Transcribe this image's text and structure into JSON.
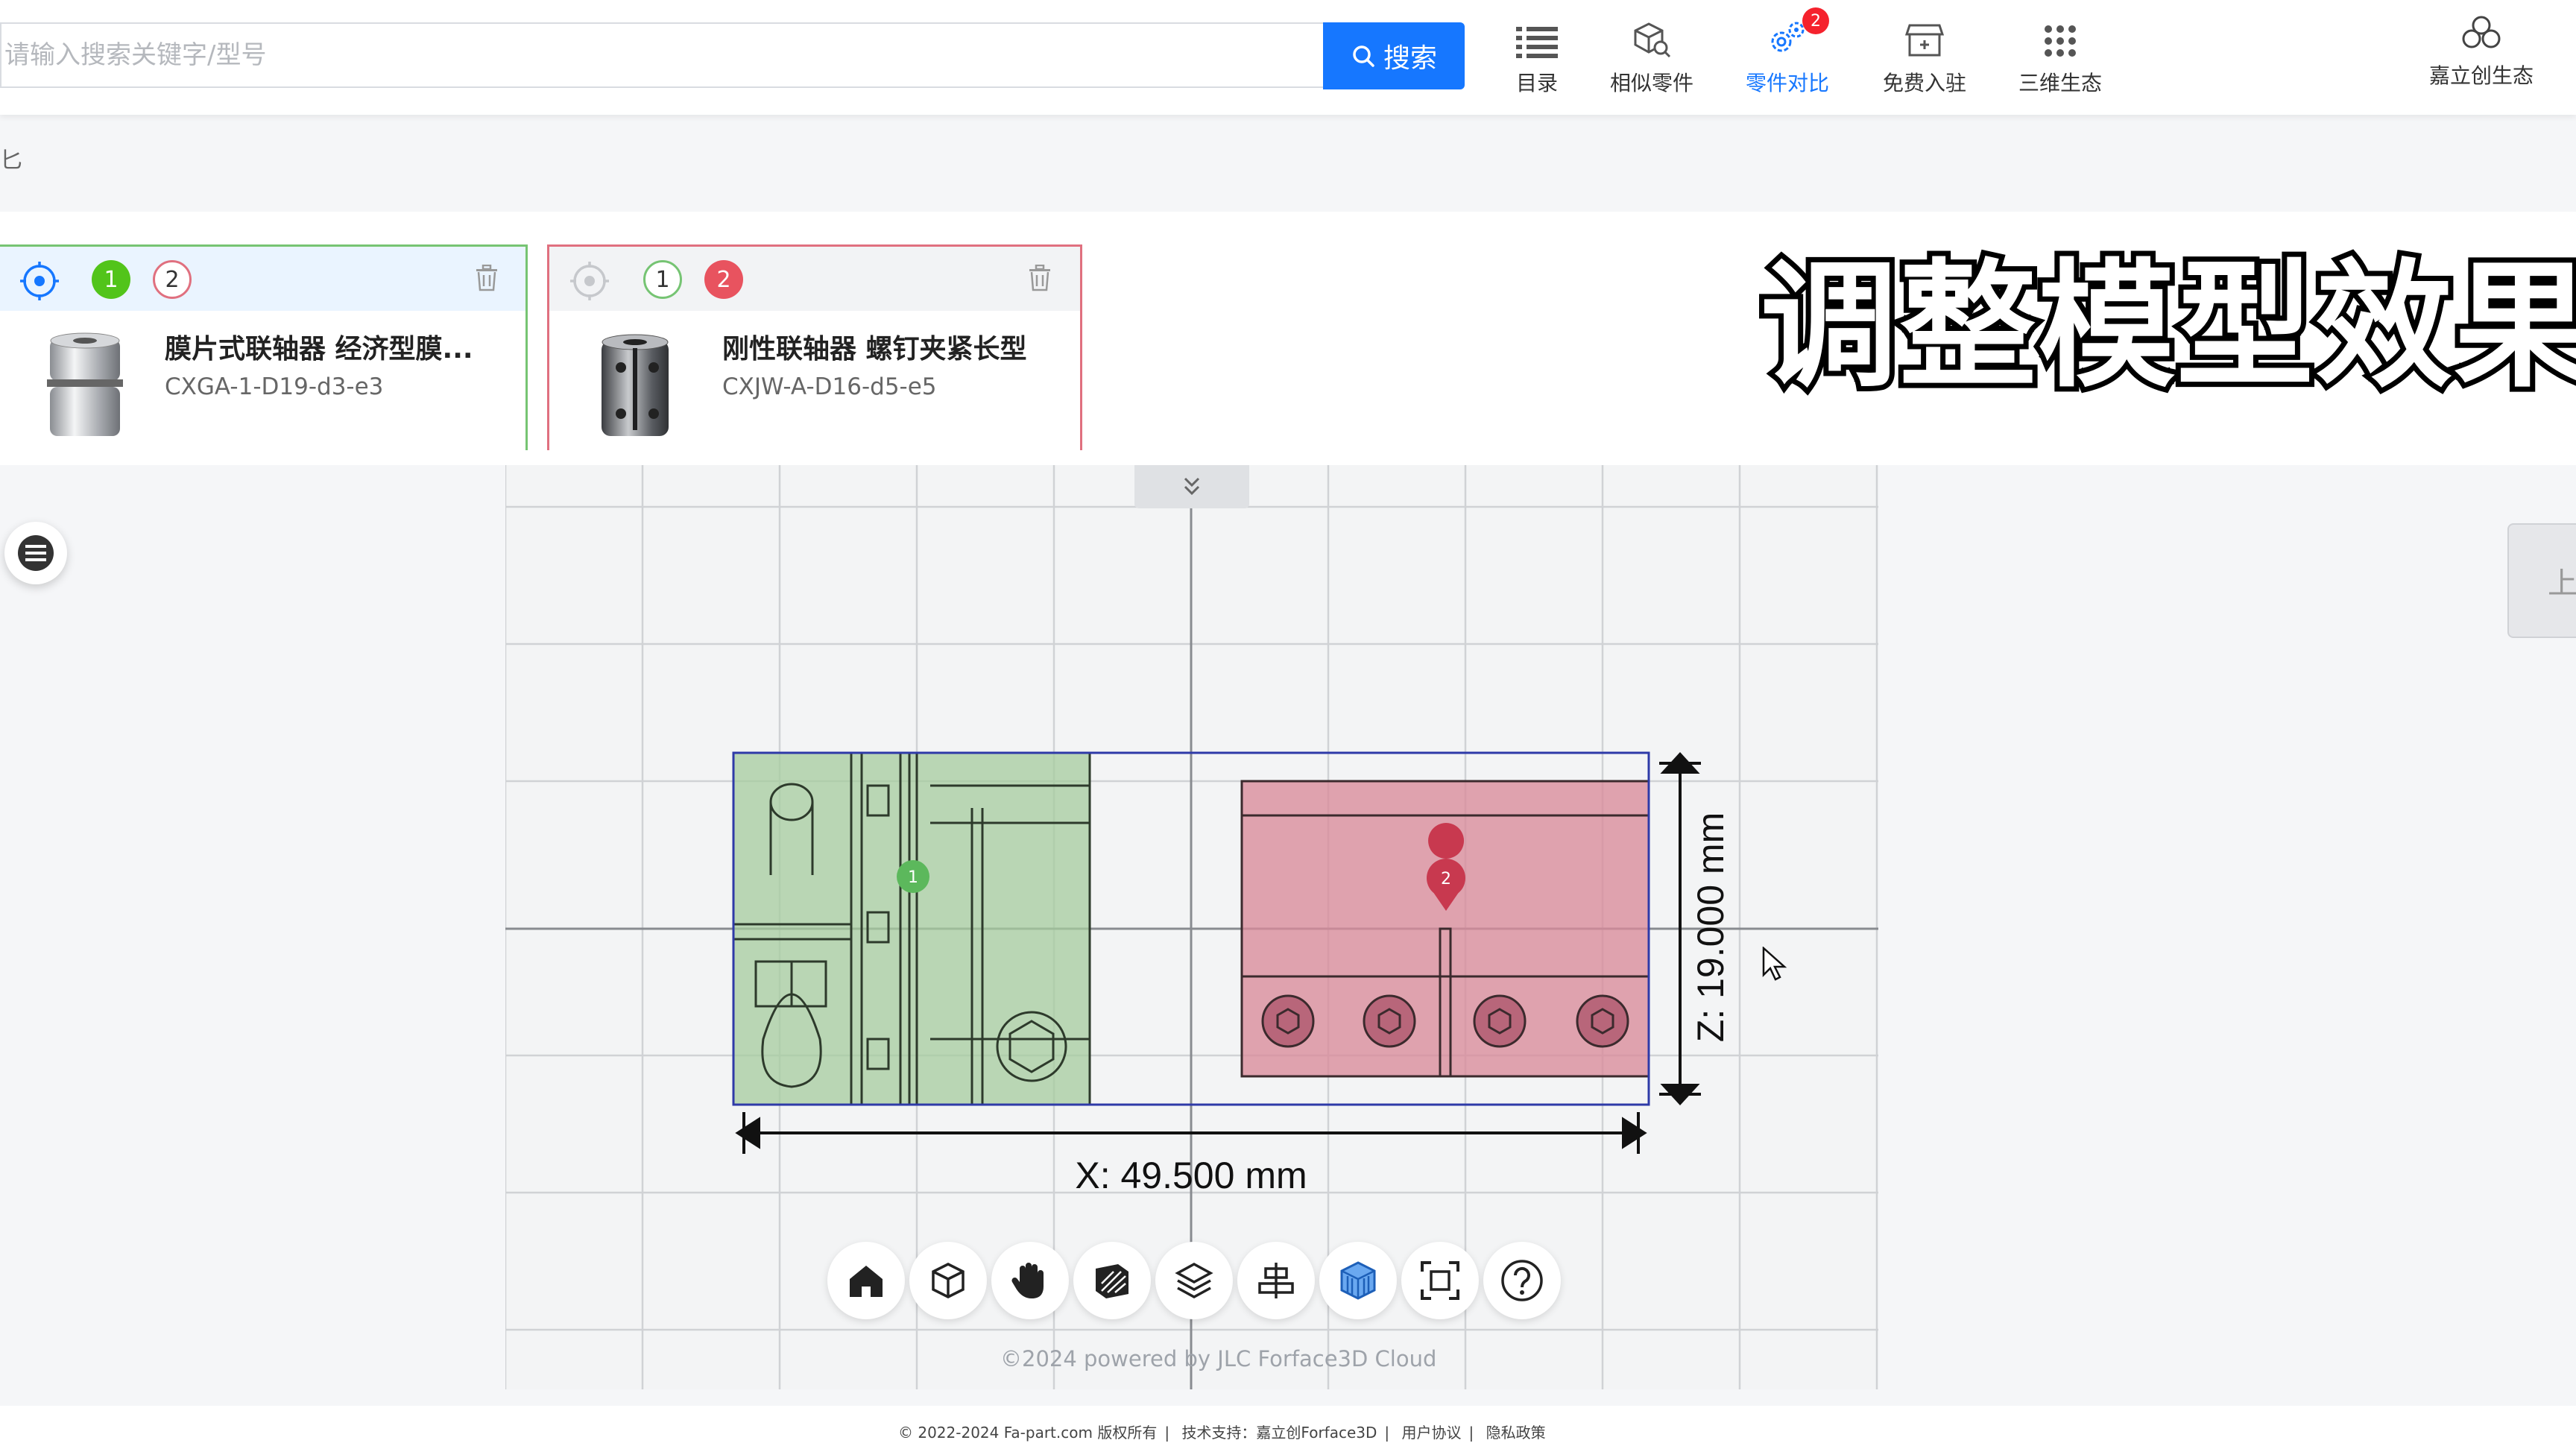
{
  "search": {
    "placeholder": "请输入搜索关键字/型号",
    "button_label": "搜索"
  },
  "nav": {
    "items": [
      {
        "label": "目录",
        "icon": "list-icon"
      },
      {
        "label": "相似零件",
        "icon": "cube-search-icon"
      },
      {
        "label": "零件对比",
        "icon": "gears-icon",
        "badge": "2",
        "active": true
      },
      {
        "label": "免费入驻",
        "icon": "shop-icon"
      },
      {
        "label": "三维生态",
        "icon": "dots-grid-icon"
      }
    ],
    "brand_label": "嘉立创生态"
  },
  "breadcrumb_fragment": "匕",
  "compare": {
    "cards": [
      {
        "n1": "1",
        "n2": "2",
        "title": "膜片式联轴器 经济型膜...",
        "model": "CXGA-1-D19-d3-e3",
        "color": "#76c473"
      },
      {
        "n1": "1",
        "n2": "2",
        "title": "刚性联轴器 螺钉夹紧长型",
        "model": "CXJW-A-D16-d5-e5",
        "color": "#e0707f"
      }
    ]
  },
  "headline": "调整模型效果",
  "viewer": {
    "dimension_x": "X: 49.500 mm",
    "dimension_z": "Z: 19.000 mm",
    "markers": [
      "1",
      "2"
    ],
    "right_tab_label": "上",
    "powered_by": "©2024 powered by JLC Forface3D Cloud",
    "toolbar_icons": [
      "home-icon",
      "cube-view-icon",
      "hand-pan-icon",
      "section-icon",
      "layers-icon",
      "align-icon",
      "wireframe-cube-icon",
      "fit-screen-icon",
      "help-icon"
    ]
  },
  "footer": {
    "copyright": "© 2022-2024 Fa-part.com 版权所有",
    "support": "技术支持：嘉立创Forface3D",
    "terms": "用户协议",
    "privacy": "隐私政策"
  },
  "colors": {
    "accent": "#1677ff",
    "green_model": "#a5cc9e",
    "red_model": "#d98b9a",
    "badge_red": "#f5222d"
  }
}
